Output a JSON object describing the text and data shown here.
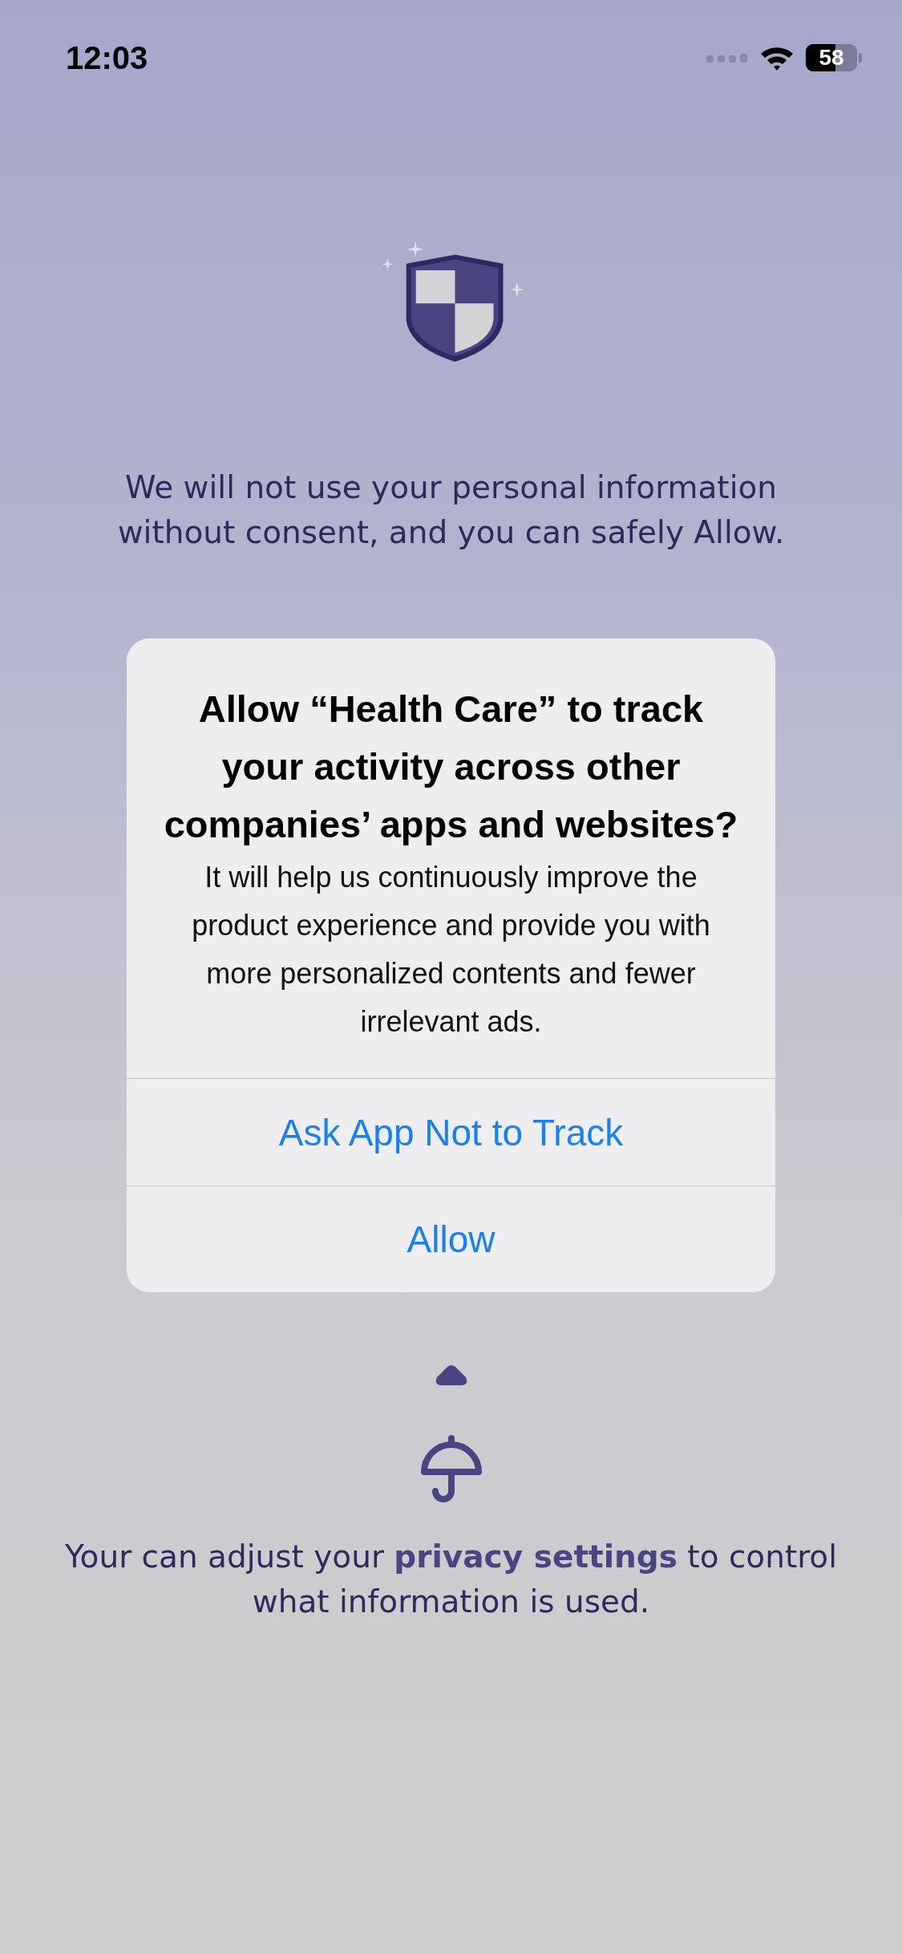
{
  "status_bar": {
    "time": "12:03",
    "battery": "58"
  },
  "intro_text": "We will not use your personal information without consent, and you can safely Allow.",
  "alert": {
    "title": "Allow “Health Care” to track your activity across other companies’ apps and websites?",
    "message": "It will help us continuously improve the product experience and provide you with more personalized contents and fewer irrelevant ads.",
    "buttons": [
      "Ask App Not to Track",
      "Allow"
    ]
  },
  "footer_text": {
    "before": "Your can adjust your",
    "link": "privacy settings",
    "after": "to control what information is used."
  }
}
